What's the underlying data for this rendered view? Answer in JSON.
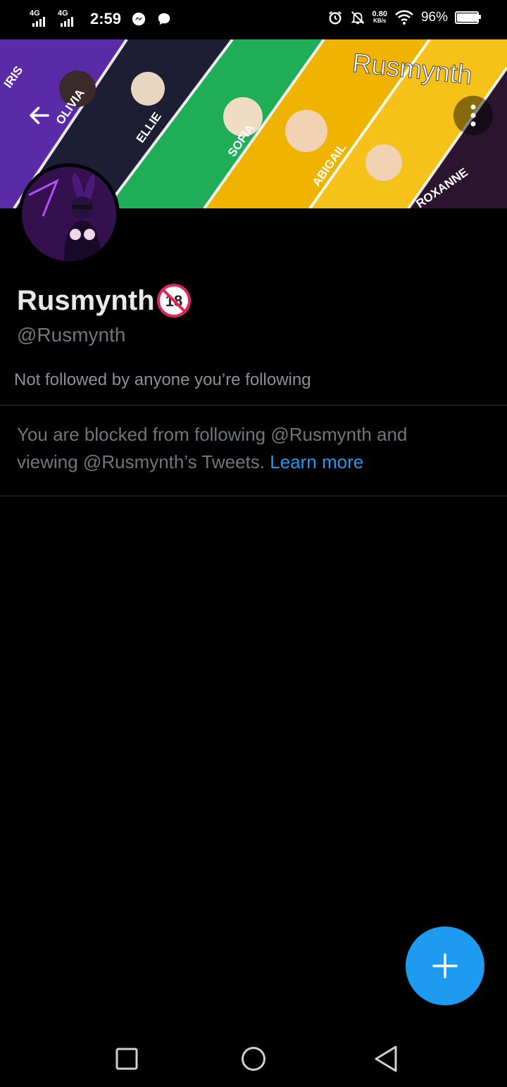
{
  "status_bar": {
    "signal1_label": "4G",
    "signal2_label": "4G",
    "time": "2:59",
    "net_speed_value": "0.80",
    "net_speed_unit": "KB/s",
    "battery_percent": "96%",
    "battery_level": 0.96,
    "icons": [
      "messenger-icon",
      "chat-bubble-icon",
      "alarm-icon",
      "notifications-off-icon",
      "wifi-icon",
      "battery-icon"
    ]
  },
  "banner": {
    "title": "Rusmynth",
    "names": [
      "IRIS",
      "OLIVIA",
      "ELLIE",
      "SOFIA",
      "ABIGAIL",
      "ROXANNE"
    ],
    "colors": [
      "#6a2fb0",
      "#1b1b2f",
      "#22b35a",
      "#f2b705",
      "#f5a800",
      "#2a1530"
    ]
  },
  "profile": {
    "name": "Rusmynth",
    "badge": "🔞",
    "handle": "@Rusmynth",
    "followed_by": "Not followed by anyone you’re following",
    "blocked_text": "You are blocked from following @Rusmynth and viewing @Rusmynth’s Tweets.",
    "learn_more": "Learn more"
  },
  "colors": {
    "accent": "#1d9bf0",
    "background": "#000000",
    "secondary_text": "#71767b",
    "divider": "#2f3336"
  }
}
